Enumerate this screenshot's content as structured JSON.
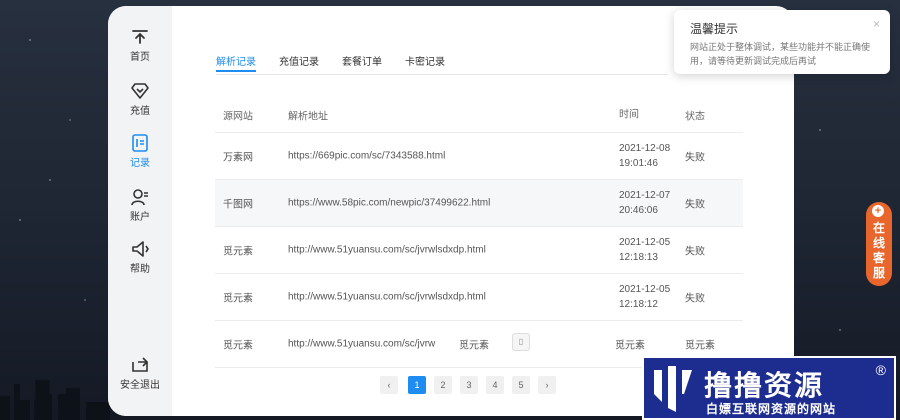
{
  "sidebar": {
    "items": [
      {
        "label": "首页",
        "icon": "home-icon"
      },
      {
        "label": "充值",
        "icon": "recharge-icon"
      },
      {
        "label": "记录",
        "icon": "record-icon",
        "active": true
      },
      {
        "label": "账户",
        "icon": "account-icon"
      },
      {
        "label": "帮助",
        "icon": "help-icon"
      }
    ],
    "logout": {
      "label": "安全退出",
      "icon": "logout-icon"
    }
  },
  "tabs": [
    {
      "label": "解析记录",
      "active": true
    },
    {
      "label": "充值记录"
    },
    {
      "label": "套餐订单"
    },
    {
      "label": "卡密记录"
    }
  ],
  "table": {
    "headers": [
      "源网站",
      "解析地址",
      "时间",
      "状态"
    ],
    "rows": [
      {
        "site": "万素网",
        "url": "https://669pic.com/sc/7343588.html",
        "date": "2021-12-08",
        "time": "19:01:46",
        "status": "失败"
      },
      {
        "site": "千图网",
        "url": "https://www.58pic.com/newpic/37499622.html",
        "date": "2021-12-07",
        "time": "20:46:06",
        "status": "失败"
      },
      {
        "site": "觅元素",
        "url": "http://www.51yuansu.com/sc/jvrwlsdxdp.html",
        "date": "2021-12-05",
        "time": "12:18:13",
        "status": "失败"
      },
      {
        "site": "觅元素",
        "url": "http://www.51yuansu.com/sc/jvrwlsdxdp.html",
        "date": "2021-12-05",
        "time": "12:18:12",
        "status": "失败"
      }
    ],
    "last_row": {
      "site": "觅元素",
      "url": "http://www.51yuansu.com/sc/jvrw",
      "tooltip_text": "觅元素",
      "copy_glyph": "▯",
      "col3": "觅元素",
      "col4": "觅元素"
    }
  },
  "pagination": {
    "prev": "‹",
    "pages": [
      "1",
      "2",
      "3",
      "4",
      "5"
    ],
    "current": "1",
    "next": "›"
  },
  "notice": {
    "title": "温馨提示",
    "message": "网站正处于整体调试，某些功能并不能正确使用，请等待更新调试完成后再试",
    "close": "×"
  },
  "customer_service": {
    "plus": "+",
    "label": "在线客服"
  },
  "watermark": {
    "main": "撸撸资源",
    "reg": "®",
    "sub": "白嫖互联网资源的网站"
  },
  "colors": {
    "accent": "#1e8cf0",
    "service": "#e8662c",
    "watermark_bg": "#1d2c8f"
  }
}
